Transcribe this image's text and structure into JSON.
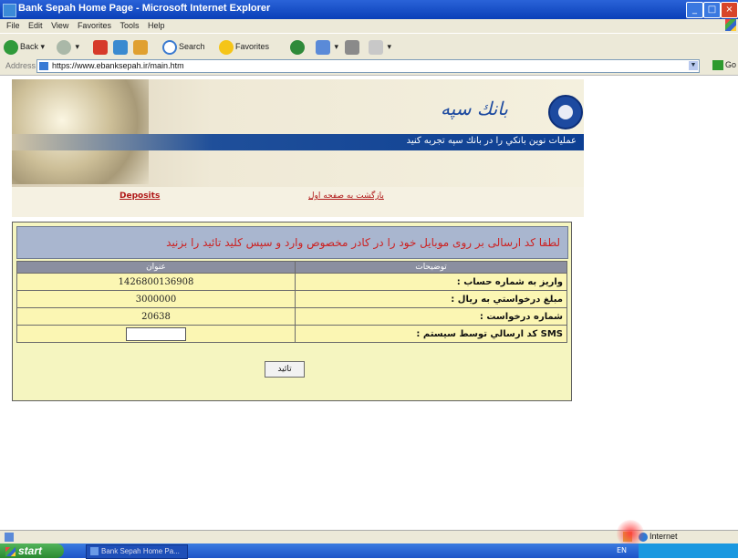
{
  "window": {
    "title": "Bank Sepah Home Page - Microsoft Internet Explorer"
  },
  "menu": [
    "File",
    "Edit",
    "View",
    "Favorites",
    "Tools",
    "Help"
  ],
  "toolbar": {
    "back": "Back",
    "search": "Search",
    "favorites": "Favorites"
  },
  "address": {
    "label": "Address",
    "url": "https://www.ebanksepah.ir/main.htm",
    "go": "Go"
  },
  "header": {
    "logo_text": "بانك سپه",
    "tagline": "عمليات نوين بانكي را در بانك سپه تجربه كنيد",
    "link_en": "Deposits",
    "link_fa": "بازگشت به صفحه اول"
  },
  "form": {
    "instruction": "لطفا کد ارسالی بر روی موبایل خود را در کادر مخصوص وارد و سپس کلید تائید را بزنید",
    "col_value": "عنوان",
    "col_desc": "توضيحات",
    "rows": [
      {
        "value": "1426800136908",
        "label": "واريز به شماره حساب :"
      },
      {
        "value": "3000000",
        "label": "مبلغ درخواستي به ريال :"
      },
      {
        "value": "20638",
        "label": "شماره درخواست :"
      }
    ],
    "sms_label": "SMS كد ارسالي توسط سيستم :",
    "sms_value": "",
    "submit": "تائيد"
  },
  "status": {
    "zone": "Internet"
  },
  "taskbar": {
    "start": "start",
    "item": "Bank Sepah Home Pa...",
    "lang": "EN"
  }
}
